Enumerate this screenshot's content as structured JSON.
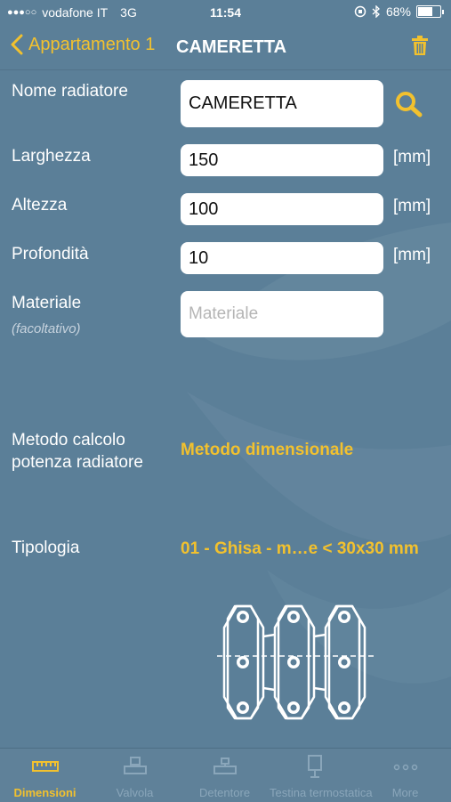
{
  "status": {
    "carrier": "vodafone IT",
    "network": "3G",
    "time": "11:54",
    "battery": "68%",
    "battery_level": 0.68
  },
  "nav": {
    "back_label": "Appartamento 1",
    "title": "CAMERETTA"
  },
  "form": {
    "name_label": "Nome radiatore",
    "name_value": "CAMERETTA",
    "width_label": "Larghezza",
    "width_value": "150",
    "width_unit": "[mm]",
    "height_label": "Altezza",
    "height_value": "100",
    "height_unit": "[mm]",
    "depth_label": "Profondità",
    "depth_value": "10",
    "depth_unit": "[mm]",
    "material_label": "Materiale",
    "material_note": "(facoltativo)",
    "material_placeholder": "Materiale",
    "method_label_line1": "Metodo calcolo",
    "method_label_line2": "potenza radiatore",
    "method_value": "Metodo dimensionale",
    "type_label": "Tipologia",
    "type_value": "01 - Ghisa - m…e < 30x30 mm"
  },
  "tabs": [
    {
      "label": "Dimensioni",
      "icon": "ruler-icon",
      "active": true
    },
    {
      "label": "Valvola",
      "icon": "valve-icon",
      "active": false
    },
    {
      "label": "Detentore",
      "icon": "lockshield-icon",
      "active": false
    },
    {
      "label": "Testina termostatica",
      "icon": "thermostatic-head-icon",
      "active": false
    },
    {
      "label": "More",
      "icon": "more-icon",
      "active": false
    }
  ],
  "colors": {
    "background": "#5b7f98",
    "accent": "#f2c12e",
    "tab_inactive": "#8aa6ba"
  }
}
